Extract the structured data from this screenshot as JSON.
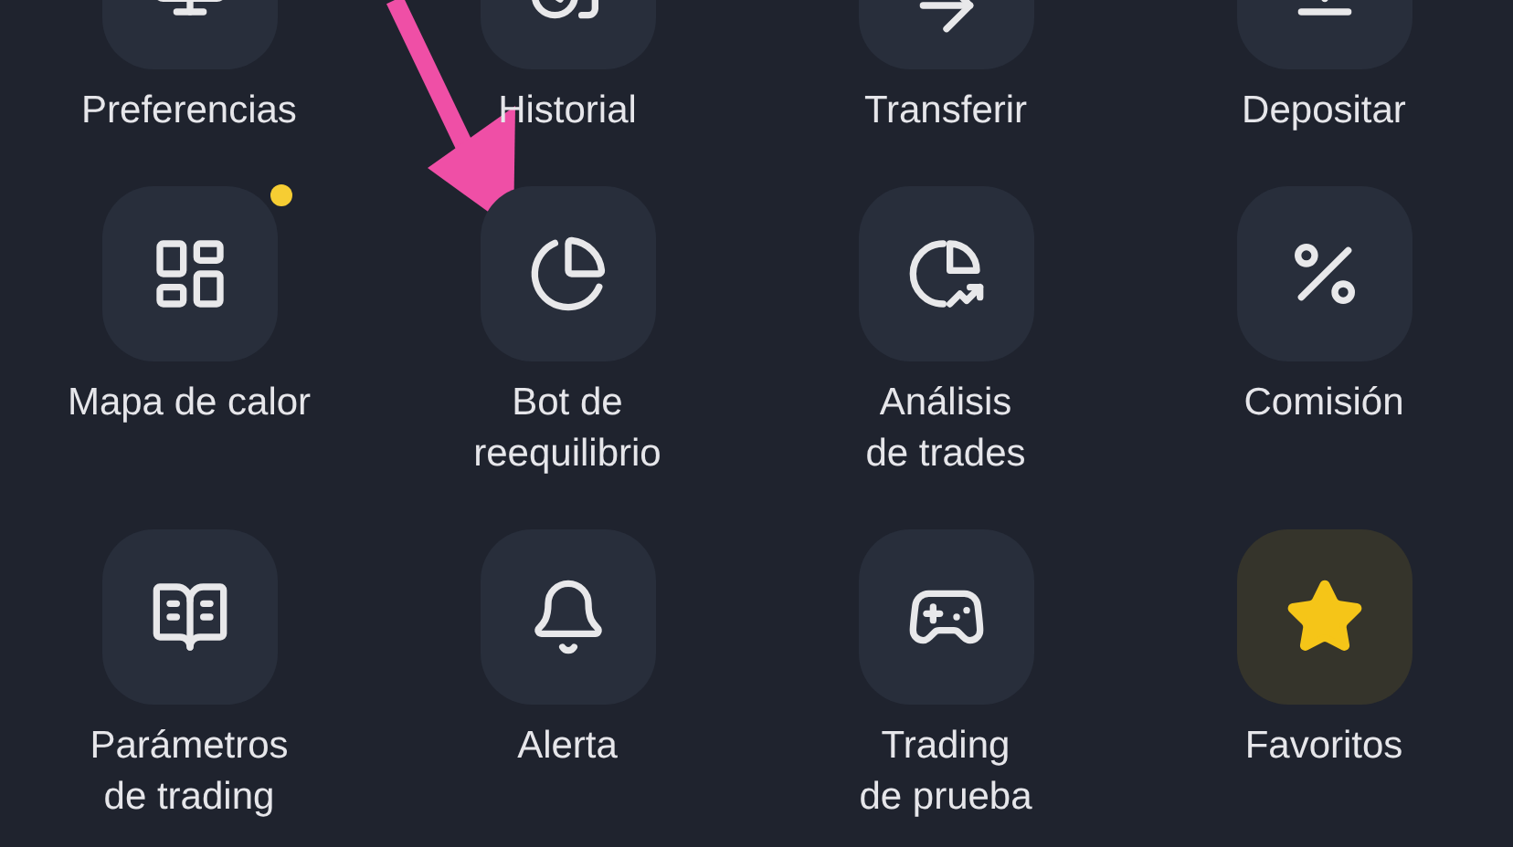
{
  "items": [
    {
      "label": "Preferencias",
      "highlighted": false,
      "dot": false
    },
    {
      "label": "Historial",
      "highlighted": false,
      "dot": false
    },
    {
      "label": "Transferir",
      "highlighted": false,
      "dot": false
    },
    {
      "label": "Depositar",
      "highlighted": false,
      "dot": false
    },
    {
      "label": "Mapa de calor",
      "highlighted": false,
      "dot": true
    },
    {
      "label": "Bot de\nreequilibrio",
      "highlighted": false,
      "dot": false
    },
    {
      "label": "Análisis\nde trades",
      "highlighted": false,
      "dot": false
    },
    {
      "label": "Comisión",
      "highlighted": false,
      "dot": false
    },
    {
      "label": "Parámetros\nde trading",
      "highlighted": false,
      "dot": false
    },
    {
      "label": "Alerta",
      "highlighted": false,
      "dot": false
    },
    {
      "label": "Trading\nde prueba",
      "highlighted": false,
      "dot": false
    },
    {
      "label": "Favoritos",
      "highlighted": true,
      "dot": false
    }
  ]
}
